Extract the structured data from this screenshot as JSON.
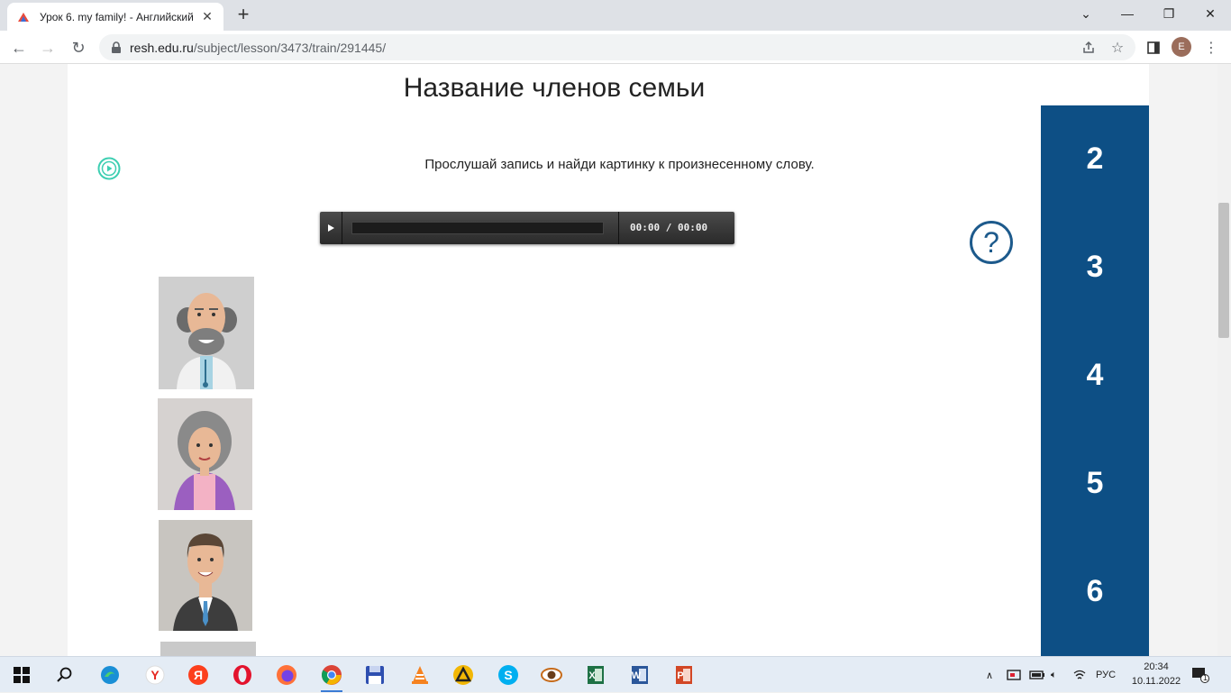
{
  "browser": {
    "tab_title": "Урок 6. my family! - Английский",
    "new_tab": "+",
    "url_host": "resh.edu.ru",
    "url_path": "/subject/lesson/3473/train/291445/",
    "profile_initial": "E"
  },
  "page": {
    "title": "Название членов семьи",
    "instruction": "Прослушай запись и найди картинку к произнесенному слову.",
    "audio_time": "00:00 / 00:00",
    "help_symbol": "?"
  },
  "cards": [
    {
      "name": "grandfather",
      "bg": "#cfcfcf"
    },
    {
      "name": "grandmother",
      "bg": "#d6d2d0"
    },
    {
      "name": "father",
      "bg": "#c8c5c0"
    },
    {
      "name": "partial",
      "bg": "#c9c9c9"
    }
  ],
  "sidebar": {
    "numbers": [
      "2",
      "3",
      "4",
      "5",
      "6"
    ],
    "color": "#0d4f85"
  },
  "taskbar": {
    "language": "РУС",
    "time": "20:34",
    "date": "10.11.2022",
    "notifications": "1"
  }
}
